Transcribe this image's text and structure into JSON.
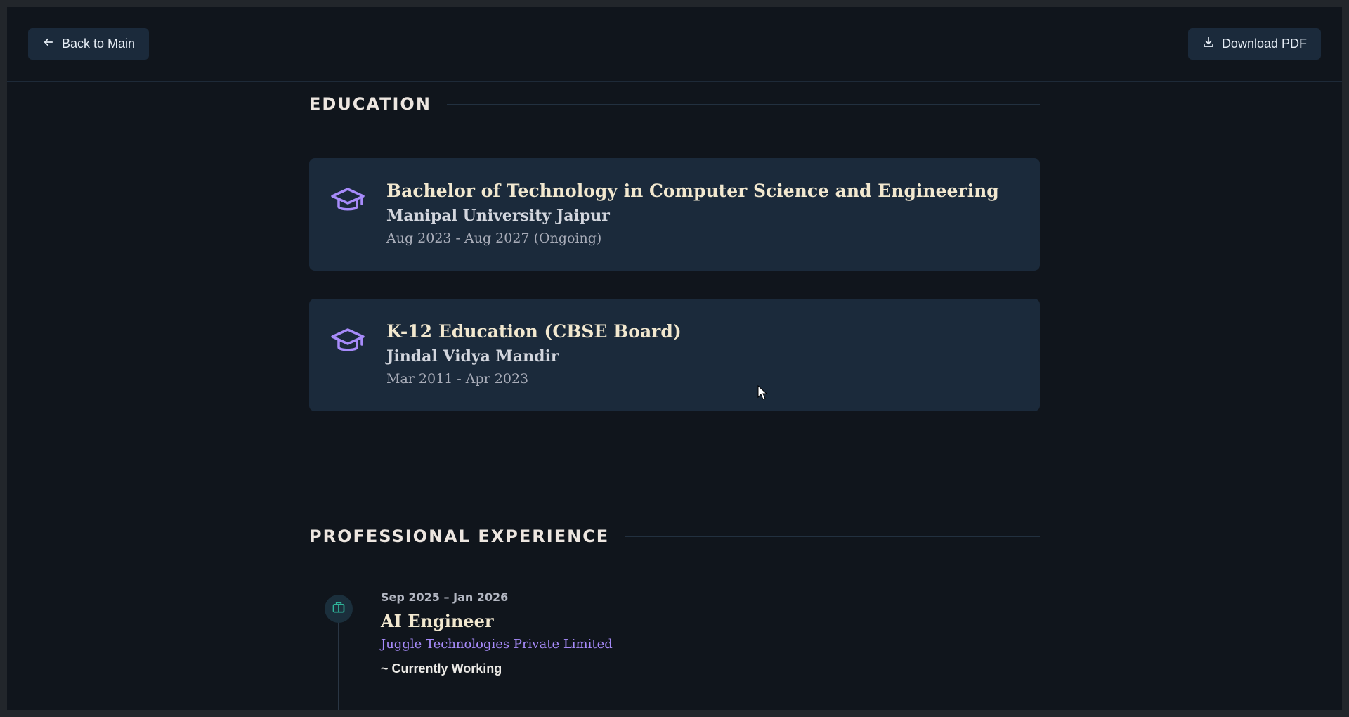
{
  "header": {
    "back_label": "Back to Main",
    "download_label": "Download PDF"
  },
  "education": {
    "title": "EDUCATION",
    "items": [
      {
        "degree": "Bachelor of Technology in Computer Science and Engineering",
        "school": "Manipal University Jaipur",
        "dates": "Aug 2023 - Aug 2027 (Ongoing)",
        "icon": "graduation-cap-icon"
      },
      {
        "degree": "K-12 Education (CBSE Board)",
        "school": "Jindal Vidya Mandir",
        "dates": "Mar 2011 - Apr 2023",
        "icon": "graduation-cap-icon"
      }
    ]
  },
  "experience": {
    "title": "PROFESSIONAL EXPERIENCE",
    "items": [
      {
        "dates": "Sep 2025 – Jan 2026",
        "role": "AI Engineer",
        "company": "Juggle Technologies Private Limited",
        "status": "~ Currently Working",
        "icon": "briefcase-icon"
      }
    ]
  },
  "colors": {
    "background": "#10151c",
    "card": "#1b2a3b",
    "accent": "#a78bfa",
    "heading": "#f2e8cf",
    "timeline_icon": "#2fb59a"
  }
}
